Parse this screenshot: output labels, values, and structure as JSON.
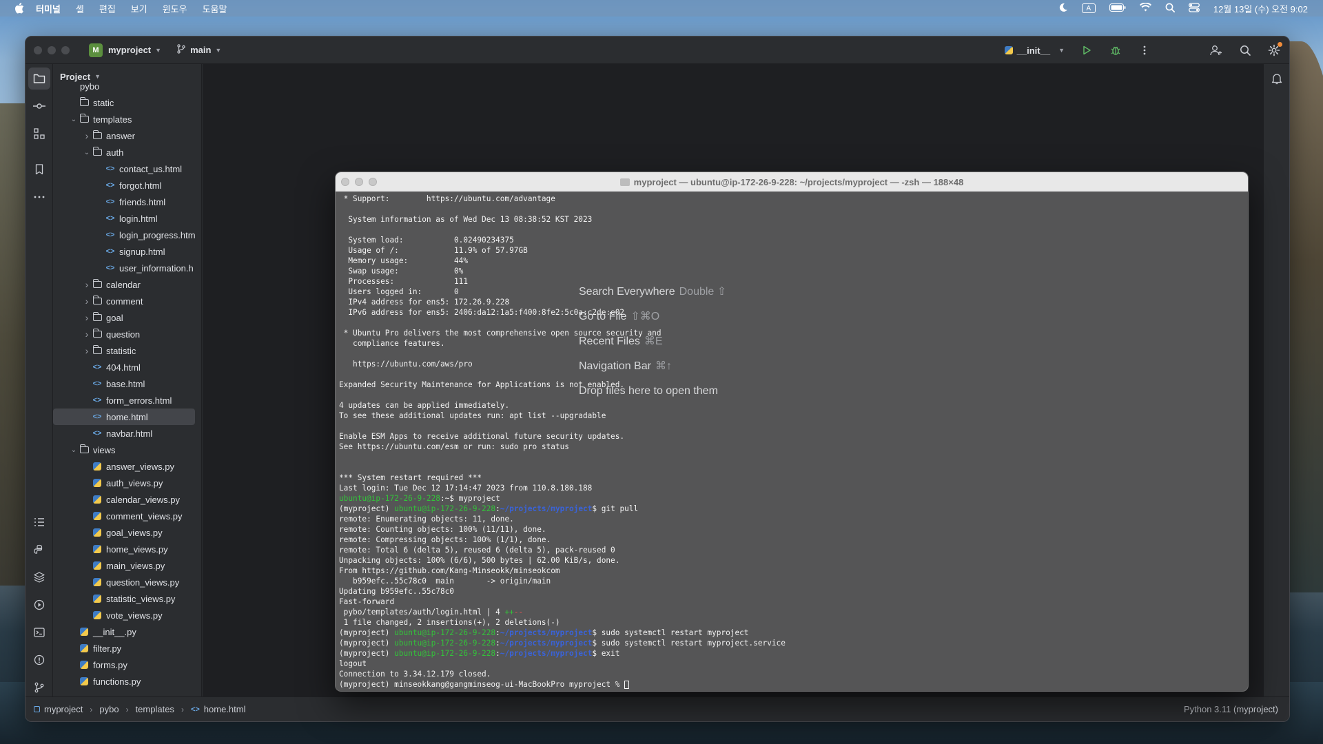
{
  "menubar": {
    "app": "터미널",
    "items": [
      "셸",
      "편집",
      "보기",
      "윈도우",
      "도움말"
    ],
    "input_source": "A",
    "datetime": "12월 13일 (수) 오전 9:02"
  },
  "ide": {
    "project_badge": "M",
    "project_name": "myproject",
    "branch": "main",
    "run_config": "__init__",
    "panel_title": "Project"
  },
  "tree": [
    {
      "label": "pybo",
      "type": "folder",
      "level": 0,
      "open": true,
      "partial": true
    },
    {
      "label": "static",
      "type": "folder",
      "level": 1,
      "open": false,
      "no_arrow": true
    },
    {
      "label": "templates",
      "type": "folder",
      "level": 1,
      "open": true
    },
    {
      "label": "answer",
      "type": "folder",
      "level": 2,
      "open": false
    },
    {
      "label": "auth",
      "type": "folder",
      "level": 2,
      "open": true
    },
    {
      "label": "contact_us.html",
      "type": "html",
      "level": 3
    },
    {
      "label": "forgot.html",
      "type": "html",
      "level": 3
    },
    {
      "label": "friends.html",
      "type": "html",
      "level": 3
    },
    {
      "label": "login.html",
      "type": "html",
      "level": 3
    },
    {
      "label": "login_progress.htm",
      "type": "html",
      "level": 3
    },
    {
      "label": "signup.html",
      "type": "html",
      "level": 3
    },
    {
      "label": "user_information.h",
      "type": "html",
      "level": 3
    },
    {
      "label": "calendar",
      "type": "folder",
      "level": 2,
      "open": false
    },
    {
      "label": "comment",
      "type": "folder",
      "level": 2,
      "open": false
    },
    {
      "label": "goal",
      "type": "folder",
      "level": 2,
      "open": false
    },
    {
      "label": "question",
      "type": "folder",
      "level": 2,
      "open": false
    },
    {
      "label": "statistic",
      "type": "folder",
      "level": 2,
      "open": false
    },
    {
      "label": "404.html",
      "type": "html",
      "level": 2
    },
    {
      "label": "base.html",
      "type": "html",
      "level": 2
    },
    {
      "label": "form_errors.html",
      "type": "html",
      "level": 2
    },
    {
      "label": "home.html",
      "type": "html",
      "level": 2,
      "selected": true
    },
    {
      "label": "navbar.html",
      "type": "html",
      "level": 2
    },
    {
      "label": "views",
      "type": "folder",
      "level": 1,
      "open": true
    },
    {
      "label": "answer_views.py",
      "type": "py",
      "level": 2
    },
    {
      "label": "auth_views.py",
      "type": "py",
      "level": 2
    },
    {
      "label": "calendar_views.py",
      "type": "py",
      "level": 2
    },
    {
      "label": "comment_views.py",
      "type": "py",
      "level": 2
    },
    {
      "label": "goal_views.py",
      "type": "py",
      "level": 2
    },
    {
      "label": "home_views.py",
      "type": "py",
      "level": 2
    },
    {
      "label": "main_views.py",
      "type": "py",
      "level": 2
    },
    {
      "label": "question_views.py",
      "type": "py",
      "level": 2
    },
    {
      "label": "statistic_views.py",
      "type": "py",
      "level": 2
    },
    {
      "label": "vote_views.py",
      "type": "py",
      "level": 2
    },
    {
      "label": "__init__.py",
      "type": "py",
      "level": 1
    },
    {
      "label": "filter.py",
      "type": "py",
      "level": 1
    },
    {
      "label": "forms.py",
      "type": "py",
      "level": 1
    },
    {
      "label": "functions.py",
      "type": "py",
      "level": 1
    }
  ],
  "overlay": {
    "items": [
      {
        "label": "Search Everywhere",
        "key": "Double ⇧"
      },
      {
        "label": "Go to File",
        "key": "⇧⌘O"
      },
      {
        "label": "Recent Files",
        "key": "⌘E"
      },
      {
        "label": "Navigation Bar",
        "key": "⌘↑"
      },
      {
        "label": "Drop files here to open them",
        "key": ""
      }
    ]
  },
  "terminal": {
    "title": "myproject — ubuntu@ip-172-26-9-228: ~/projects/myproject — -zsh — 188×48",
    "lines": [
      [
        {
          "t": " * Support:        https://ubuntu.com/advantage"
        }
      ],
      [
        {
          "t": ""
        }
      ],
      [
        {
          "t": "  System information as of Wed Dec 13 08:38:52 KST 2023"
        }
      ],
      [
        {
          "t": ""
        }
      ],
      [
        {
          "t": "  System load:           0.02490234375"
        }
      ],
      [
        {
          "t": "  Usage of /:            11.9% of 57.97GB"
        }
      ],
      [
        {
          "t": "  Memory usage:          44%"
        }
      ],
      [
        {
          "t": "  Swap usage:            0%"
        }
      ],
      [
        {
          "t": "  Processes:             111"
        }
      ],
      [
        {
          "t": "  Users logged in:       0"
        }
      ],
      [
        {
          "t": "  IPv4 address for ens5: 172.26.9.228"
        }
      ],
      [
        {
          "t": "  IPv6 address for ens5: 2406:da12:1a5:f400:8fe2:5c0a:c2de:e02"
        }
      ],
      [
        {
          "t": ""
        }
      ],
      [
        {
          "t": " * Ubuntu Pro delivers the most comprehensive open source security and"
        }
      ],
      [
        {
          "t": "   compliance features."
        }
      ],
      [
        {
          "t": ""
        }
      ],
      [
        {
          "t": "   https://ubuntu.com/aws/pro"
        }
      ],
      [
        {
          "t": ""
        }
      ],
      [
        {
          "t": "Expanded Security Maintenance for Applications is not enabled."
        }
      ],
      [
        {
          "t": ""
        }
      ],
      [
        {
          "t": "4 updates can be applied immediately."
        }
      ],
      [
        {
          "t": "To see these additional updates run: apt list --upgradable"
        }
      ],
      [
        {
          "t": ""
        }
      ],
      [
        {
          "t": "Enable ESM Apps to receive additional future security updates."
        }
      ],
      [
        {
          "t": "See https://ubuntu.com/esm or run: sudo pro status"
        }
      ],
      [
        {
          "t": ""
        }
      ],
      [
        {
          "t": ""
        }
      ],
      [
        {
          "t": "*** System restart required ***"
        }
      ],
      [
        {
          "t": "Last login: Tue Dec 12 17:14:47 2023 from 110.8.180.188"
        }
      ],
      [
        {
          "t": "ubuntu@ip-172-26-9-228",
          "c": "g"
        },
        {
          "t": ":~$ myproject"
        }
      ],
      [
        {
          "t": "(myproject) "
        },
        {
          "t": "ubuntu@ip-172-26-9-228",
          "c": "g"
        },
        {
          "t": ":"
        },
        {
          "t": "~/projects/myproject",
          "c": "b"
        },
        {
          "t": "$ git pull"
        }
      ],
      [
        {
          "t": "remote: Enumerating objects: 11, done."
        }
      ],
      [
        {
          "t": "remote: Counting objects: 100% (11/11), done."
        }
      ],
      [
        {
          "t": "remote: Compressing objects: 100% (1/1), done."
        }
      ],
      [
        {
          "t": "remote: Total 6 (delta 5), reused 6 (delta 5), pack-reused 0"
        }
      ],
      [
        {
          "t": "Unpacking objects: 100% (6/6), 500 bytes | 62.00 KiB/s, done."
        }
      ],
      [
        {
          "t": "From https://github.com/Kang-Minseokk/minseokcom"
        }
      ],
      [
        {
          "t": "   b959efc..55c78c0  main       -> origin/main"
        }
      ],
      [
        {
          "t": "Updating b959efc..55c78c0"
        }
      ],
      [
        {
          "t": "Fast-forward"
        }
      ],
      [
        {
          "t": " pybo/templates/auth/login.html | 4 "
        },
        {
          "t": "++",
          "c": "g"
        },
        {
          "t": "--",
          "c": "r"
        }
      ],
      [
        {
          "t": " 1 file changed, 2 insertions(+), 2 deletions(-)"
        }
      ],
      [
        {
          "t": "(myproject) "
        },
        {
          "t": "ubuntu@ip-172-26-9-228",
          "c": "g"
        },
        {
          "t": ":"
        },
        {
          "t": "~/projects/myproject",
          "c": "b"
        },
        {
          "t": "$ sudo systemctl restart myproject"
        }
      ],
      [
        {
          "t": "(myproject) "
        },
        {
          "t": "ubuntu@ip-172-26-9-228",
          "c": "g"
        },
        {
          "t": ":"
        },
        {
          "t": "~/projects/myproject",
          "c": "b"
        },
        {
          "t": "$ sudo systemctl restart myproject.service"
        }
      ],
      [
        {
          "t": "(myproject) "
        },
        {
          "t": "ubuntu@ip-172-26-9-228",
          "c": "g"
        },
        {
          "t": ":"
        },
        {
          "t": "~/projects/myproject",
          "c": "b"
        },
        {
          "t": "$ exit"
        }
      ],
      [
        {
          "t": "logout"
        }
      ],
      [
        {
          "t": "Connection to 3.34.12.179 closed."
        }
      ],
      [
        {
          "t": "(myproject) minseokkang@gangminseog-ui-MacBookPro myproject % "
        },
        {
          "t": "",
          "c": "cursor"
        }
      ]
    ]
  },
  "status": {
    "breadcrumb": [
      "myproject",
      "pybo",
      "templates",
      "home.html"
    ],
    "interpreter": "Python 3.11 (myproject)"
  },
  "colors": {
    "ide_bg": "#2b2d30",
    "terminal_bg": "#555556",
    "prompt_green": "#33c33a",
    "path_blue": "#3a63d8"
  }
}
